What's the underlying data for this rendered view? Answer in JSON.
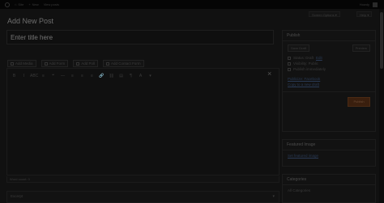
{
  "admin_bar": {
    "site_name": "Site",
    "new_label": "New",
    "extra_label": "View posts",
    "greeting": "Howdy"
  },
  "header": {
    "screen_options": "Screen Options",
    "help": "Help",
    "page_title": "Add New Post"
  },
  "editor": {
    "title_placeholder": "Enter title here",
    "media_buttons": [
      "Add Media",
      "Add Form",
      "Add Poll",
      "Add Contact Form"
    ],
    "toolbar": [
      "B",
      "I",
      "ABC",
      "≡",
      "❝",
      "—",
      "≡",
      "≡",
      "≡",
      "🔗",
      "⛓",
      "▤",
      "¶",
      "A",
      "▾"
    ],
    "word_count": "Word count: 0",
    "close_symbol": "×"
  },
  "excerpt": {
    "label": "Excerpt"
  },
  "publish_box": {
    "title": "Publish",
    "save_draft": "Save Draft",
    "preview": "Preview",
    "status": "Status: Draft",
    "visibility": "Visibility: Public",
    "schedule": "Publish immediately",
    "edit_link": "Edit",
    "extra_1": "Publicize: Facebook",
    "extra_2": "Copy to a new draft",
    "publish_button": "Publish"
  },
  "featured_image": {
    "title": "Featured Image",
    "link": "Set featured image"
  },
  "categories": {
    "title": "Categories",
    "tab": "All Categories"
  }
}
